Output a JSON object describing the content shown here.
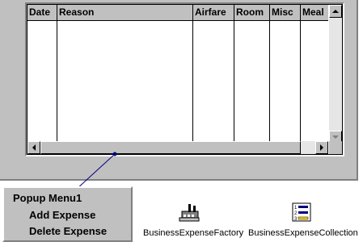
{
  "grid": {
    "columns": [
      "Date",
      "Reason",
      "Airfare",
      "Room",
      "Misc",
      "Meal"
    ]
  },
  "popup_menu": {
    "title": "Popup Menu1",
    "items": [
      "Add Expense",
      "Delete Expense"
    ]
  },
  "components": [
    {
      "label": "BusinessExpenseFactory",
      "icon": "factory-icon"
    },
    {
      "label": "BusinessExpenseCollection",
      "icon": "collection-list-icon"
    }
  ]
}
